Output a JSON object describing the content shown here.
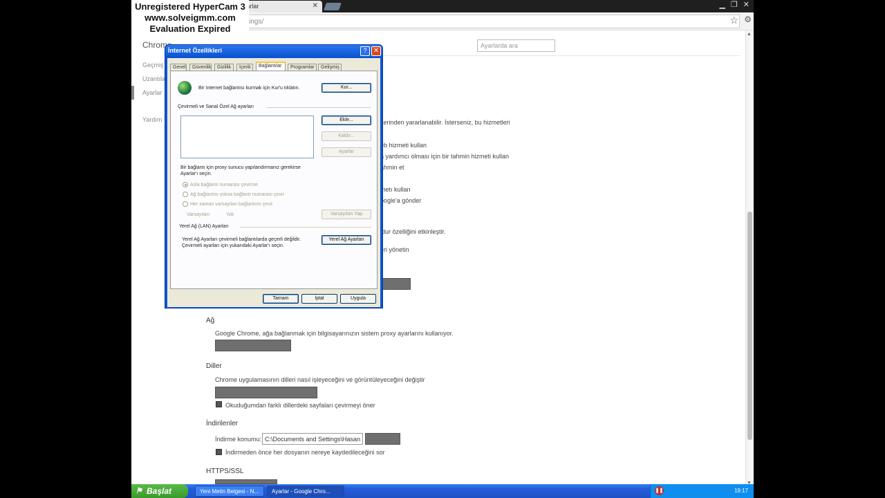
{
  "watermark": {
    "line1": "Unregistered HyperCam 3",
    "line2": "www.solveigmm.com",
    "line3": "Evaluation Expired"
  },
  "browser": {
    "tab_title": "Ayarlar",
    "address": "ettings/"
  },
  "settings": {
    "title": "Chrome",
    "search_placeholder": "Ayarlarda ara",
    "nav": [
      "Geçmiş",
      "Uzantılar",
      "Ayarlar",
      "Yardım"
    ],
    "privacy_lines": [
      "tlerinden yararlanabilir. İsterseniz, bu hizmetleri",
      "eb hizmeti kullan",
      "a yardımcı olması için bir tahmin hizmeti kullan",
      "ahmin et",
      "metı kullan",
      "oogle'a gönder",
      "ldur özelliğini etkinleştir.",
      "eri yönetin"
    ],
    "network": {
      "title": "Ağ",
      "description": "Google Chrome, ağa bağlanmak için bilgisayarınızın sistem proxy ayarlarını kullanıyor."
    },
    "languages": {
      "title": "Diller",
      "description": "Chrome uygulamasının dilleri nasıl işleyeceğini ve görüntüleyeceğini değiştir",
      "translate_checkbox": "Okuduğumdan farklı dillerdeki sayfaları çevirmeyi öner"
    },
    "downloads": {
      "title": "İndirilenler",
      "location_label": "İndirme konumu:",
      "location_value": "C:\\Documents and Settings\\Hasan B",
      "ask_checkbox": "İndirmeden önce her dosyanın nereye kaydedileceğini sor"
    },
    "https": {
      "title": "HTTPS/SSL"
    }
  },
  "dialog": {
    "title": "İnternet Özellikleri",
    "help": "?",
    "close": "✕",
    "tabs": [
      "Genel",
      "Güvenlik",
      "Gizlilik",
      "İçerik",
      "Bağlantılar",
      "Programlar",
      "Gelişmiş"
    ],
    "active_tab": "Bağlantılar",
    "setup_text": "Bir Internet bağlantısı kurmak için Kur'u tıklatın.",
    "setup_button": "Kur...",
    "dialup_group": "Çevirmeli ve Sanal Özel Ağ ayarları",
    "add_button": "Ekle...",
    "remove_button": "Kaldır...",
    "settings_button": "Ayarlar",
    "proxy_hint_1": "Bir bağlantı için proxy sunucu yapılandırmanız gerekirse",
    "proxy_hint_2": "Ayarlar'ı seçin.",
    "radios": [
      "Asla bağlantı numarası çevirme",
      "Ağ bağlantısı yoksa bağlantı numarası çevir",
      "Her zaman varsayılan bağlantımı çevir"
    ],
    "default_label": "Varsayılan:",
    "default_value": "Yok",
    "set_default_button": "Varsayılan Yap",
    "lan_group": "Yerel Ağ (LAN) Ayarları",
    "lan_text_1": "Yerel Ağ Ayarları çevirmeli bağlantılarda geçerli değildir.",
    "lan_text_2": "Çevirmeli ayarları için yukarıdaki Ayarlar'ı seçin.",
    "lan_button": "Yerel Ağ Ayarları",
    "ok_button": "Tamam",
    "cancel_button": "İptal",
    "apply_button": "Uygula"
  },
  "taskbar": {
    "start": "Başlat",
    "tasks": [
      "Yeni Metin Belgesi - N...",
      "Ayarlar - Google Chro..."
    ],
    "clock": "19:17"
  },
  "colors": {
    "xp_blue": "#245edb",
    "xp_start_green": "#3a9a2c",
    "dialog_face": "#ece9d8"
  }
}
